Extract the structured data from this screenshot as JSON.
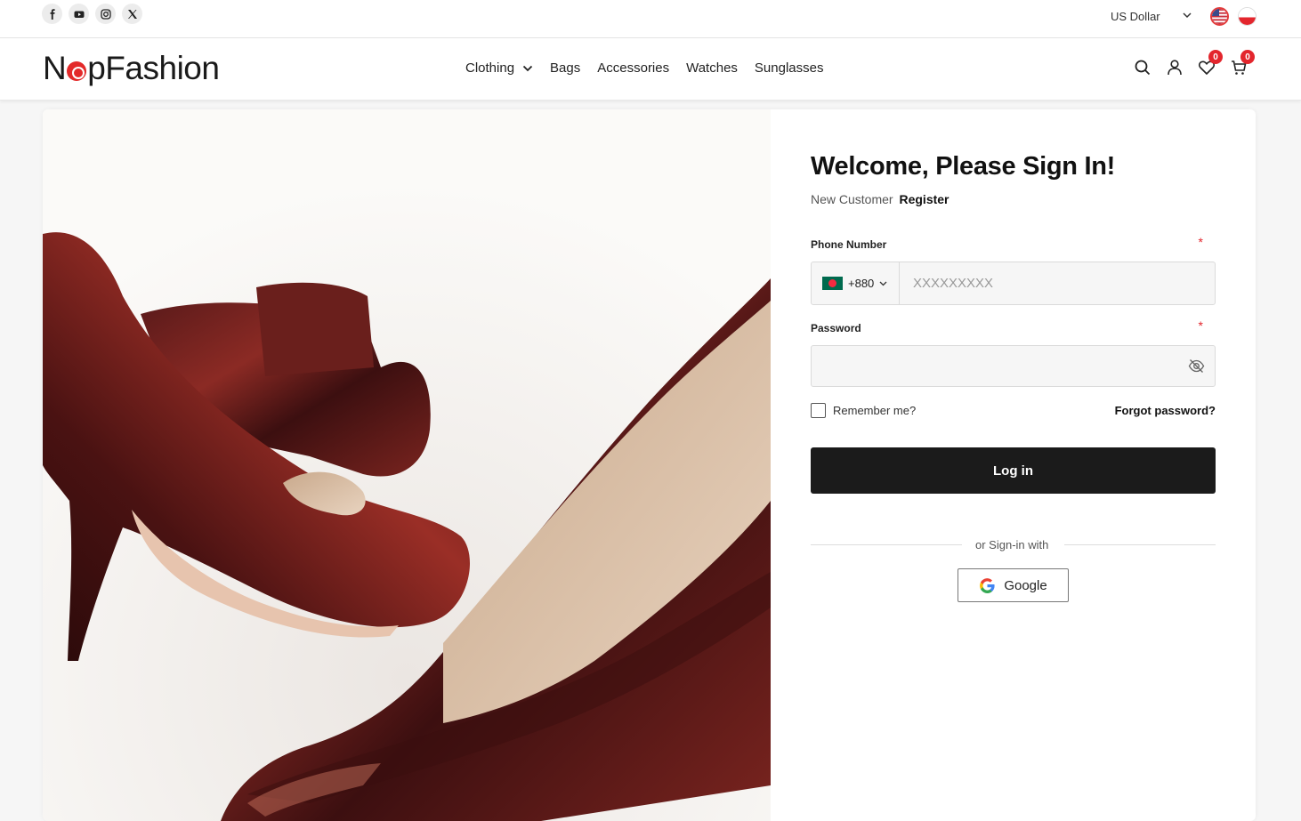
{
  "topbar": {
    "social": [
      {
        "icon": "facebook-icon"
      },
      {
        "icon": "youtube-icon"
      },
      {
        "icon": "instagram-icon"
      },
      {
        "icon": "x-twitter-icon"
      }
    ],
    "currency": "US Dollar",
    "languages": [
      "english-flag-icon",
      "polish-flag-icon"
    ]
  },
  "header": {
    "logo_prefix": "N",
    "logo_suffix": "pFashion",
    "nav": [
      "Clothing",
      "Bags",
      "Accessories",
      "Watches",
      "Sunglasses"
    ],
    "wishlist_count": "0",
    "cart_count": "0"
  },
  "login": {
    "title": "Welcome, Please Sign In!",
    "new_customer": "New Customer",
    "register": "Register",
    "phone_label": "Phone Number",
    "required_mark": "*",
    "country_code": "+880",
    "phone_placeholder": "XXXXXXXXX",
    "password_label": "Password",
    "remember": "Remember me?",
    "forgot": "Forgot password?",
    "login_button": "Log in",
    "or_signin": "or Sign-in with",
    "google": "Google"
  },
  "colors": {
    "accent": "#e3262d",
    "button": "#1b1b1b"
  }
}
